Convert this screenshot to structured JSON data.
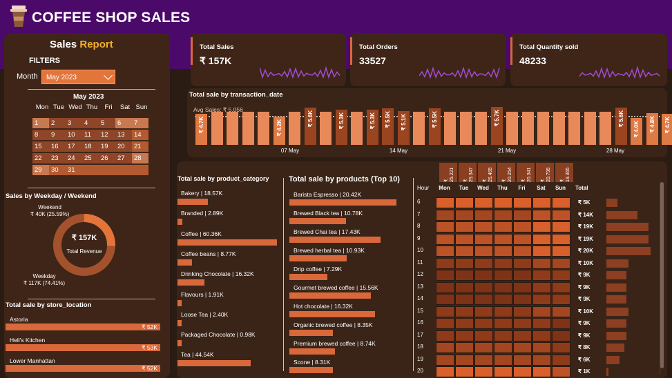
{
  "header": {
    "title": "COFFEE SHOP SALES"
  },
  "left": {
    "sales_report": "Sales",
    "report_word": "Report",
    "filters": "FILTERS",
    "month_label": "Month",
    "month_value": "May 2023",
    "calendar_title": "May 2023",
    "dow": [
      "Mon",
      "Tue",
      "Wed",
      "Thu",
      "Fri",
      "Sat",
      "Sun"
    ],
    "days": [
      "1",
      "2",
      "3",
      "4",
      "5",
      "6",
      "7",
      "8",
      "9",
      "10",
      "11",
      "12",
      "13",
      "14",
      "15",
      "16",
      "17",
      "18",
      "19",
      "20",
      "21",
      "22",
      "23",
      "24",
      "25",
      "26",
      "27",
      "28",
      "29",
      "30",
      "31"
    ],
    "weekday_title": "Sales by Weekday / Weekend",
    "weekend_label": "Weekend",
    "weekend_value": "₹ 40K (25.59%)",
    "weekday_label": "Weekday",
    "weekday_value": "₹ 117K (74.41%)",
    "donut_value": "₹ 157K",
    "donut_label": "Total Revenue",
    "weekend_share": 25.59,
    "store_title": "Total sale by store_location",
    "stores": [
      {
        "name": "Astoria",
        "value": "₹ 52K"
      },
      {
        "name": "Hell's Kitchen",
        "value": "₹ 53K"
      },
      {
        "name": "Lower Manhattan",
        "value": "₹ 52K"
      }
    ]
  },
  "kpis": [
    {
      "label": "Total Sales",
      "value": "₹ 157K"
    },
    {
      "label": "Total Orders",
      "value": "33527"
    },
    {
      "label": "Total Quantity sold",
      "value": "48233"
    }
  ],
  "date_chart": {
    "title": "Total sale by transaction_date",
    "avg_label": "Avg Sales: ₹ 5,056",
    "ticks": [
      "07 May",
      "14 May",
      "21 May",
      "28 May"
    ]
  },
  "chart_data": [
    {
      "type": "bar",
      "title": "Total sale by transaction_date",
      "x": [
        "1",
        "2",
        "3",
        "4",
        "5",
        "6",
        "7",
        "8",
        "9",
        "10",
        "11",
        "12",
        "13",
        "14",
        "15",
        "16",
        "17",
        "18",
        "19",
        "20",
        "21",
        "22",
        "23",
        "24",
        "25",
        "26",
        "27",
        "28",
        "29",
        "30",
        "31"
      ],
      "values": [
        4.7,
        5.0,
        5.0,
        5.0,
        5.0,
        4.2,
        5.0,
        5.6,
        5.0,
        5.3,
        5.0,
        5.3,
        5.5,
        5.1,
        5.0,
        5.5,
        5.0,
        5.0,
        5.0,
        5.7,
        5.0,
        5.0,
        5.0,
        5.0,
        5.0,
        5.0,
        5.0,
        5.6,
        4.0,
        4.8,
        4.7
      ],
      "labels": [
        "₹ 4.7K",
        "",
        "",
        "",
        "",
        "₹ 4.2K",
        "",
        "₹ 5.6K",
        "",
        "₹ 5.3K",
        "",
        "₹ 5.3K",
        "₹ 5.5K",
        "₹ 5.1K",
        "",
        "₹ 5.5K",
        "",
        "",
        "",
        "₹ 5.7K",
        "",
        "",
        "",
        "",
        "",
        "",
        "",
        "₹ 5.6K",
        "₹ 4.0K",
        "₹ 4.8K",
        "₹ 4.7K"
      ],
      "avg": 5.056
    },
    {
      "type": "bar",
      "title": "Total sale by product_category",
      "categories": [
        "Bakery | 18.57K",
        "Branded | 2.89K",
        "Coffee | 60.36K",
        "Coffee beans | 8.77K",
        "Drinking Chocolate | 16.32K",
        "Flavours | 1.91K",
        "Loose Tea | 2.40K",
        "Packaged Chocolate | 0.98K",
        "Tea | 44.54K"
      ],
      "values": [
        18.57,
        2.89,
        60.36,
        8.77,
        16.32,
        1.91,
        2.4,
        0.98,
        44.54
      ]
    },
    {
      "type": "bar",
      "title": "Total sale by products (Top 10)",
      "categories": [
        "Barista Espresso | 20.42K",
        "Brewed Black tea | 10.78K",
        "Brewed Chai tea | 17.43K",
        "Brewed herbal tea | 10.93K",
        "Drip coffee | 7.29K",
        "Gourmet brewed coffee | 15.56K",
        "Hot chocolate | 16.32K",
        "Organic brewed coffee | 8.35K",
        "Premium brewed coffee | 8.74K",
        "Scone | 8.31K"
      ],
      "values": [
        20.42,
        10.78,
        17.43,
        10.93,
        7.29,
        15.56,
        16.32,
        8.35,
        8.74,
        8.31
      ]
    },
    {
      "type": "heatmap",
      "title": "",
      "columns": [
        "Mon",
        "Tue",
        "Wed",
        "Thu",
        "Fri",
        "Sat",
        "Sun"
      ],
      "column_totals": [
        "₹ 25.221",
        "₹ 25.347",
        "₹ 25.465",
        "₹ 20.254",
        "₹ 20.341",
        "₹ 20.795",
        "₹ 19.365"
      ],
      "rows": [
        "6",
        "7",
        "8",
        "9",
        "10",
        "11",
        "12",
        "13",
        "14",
        "15",
        "16",
        "17",
        "18",
        "19",
        "20"
      ],
      "row_totals": [
        "₹ 5K",
        "₹ 14K",
        "₹ 19K",
        "₹ 19K",
        "₹ 20K",
        "₹ 10K",
        "₹ 9K",
        "₹ 9K",
        "₹ 9K",
        "₹ 10K",
        "₹ 9K",
        "₹ 9K",
        "₹ 8K",
        "₹ 6K",
        "₹ 1K"
      ],
      "row_values": [
        5,
        14,
        19,
        19,
        20,
        10,
        9,
        9,
        9,
        10,
        9,
        9,
        8,
        6,
        1
      ]
    }
  ],
  "heatmap": {
    "hour_label": "Hour",
    "total_label": "Total"
  },
  "colors": {
    "accent": "#d9683a",
    "header": "#4b0a6a",
    "panel": "#3f2518"
  }
}
